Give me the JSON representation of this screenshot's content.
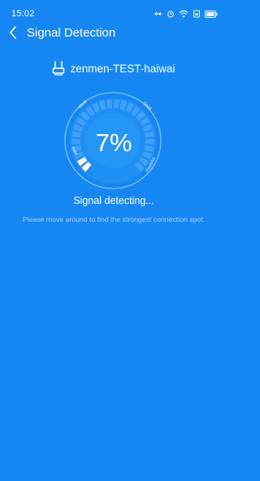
{
  "status_bar": {
    "time": "15:02",
    "icons": [
      "usb-icon",
      "alarm-icon",
      "wifi-icon",
      "sim-icon",
      "battery-icon"
    ]
  },
  "header": {
    "title": "Signal Detection",
    "back_icon": "back-arrow-icon"
  },
  "network": {
    "icon": "router-icon",
    "name": "zenmen-TEST-haiwai"
  },
  "gauge": {
    "progress_percent": 7,
    "value_label": "7%",
    "scale_labels": {
      "poor": "Poor",
      "weak": "Weak",
      "good": "Good",
      "powerful": "Powerful"
    },
    "colors": {
      "background": "#1687f2",
      "ring": "#7cc0ff",
      "inner_disc": "#2496f6",
      "active_segment": "#ffffff"
    }
  },
  "detection": {
    "status": "Signal detecting...",
    "hint": "Please move around to find the strongest connection spot."
  }
}
